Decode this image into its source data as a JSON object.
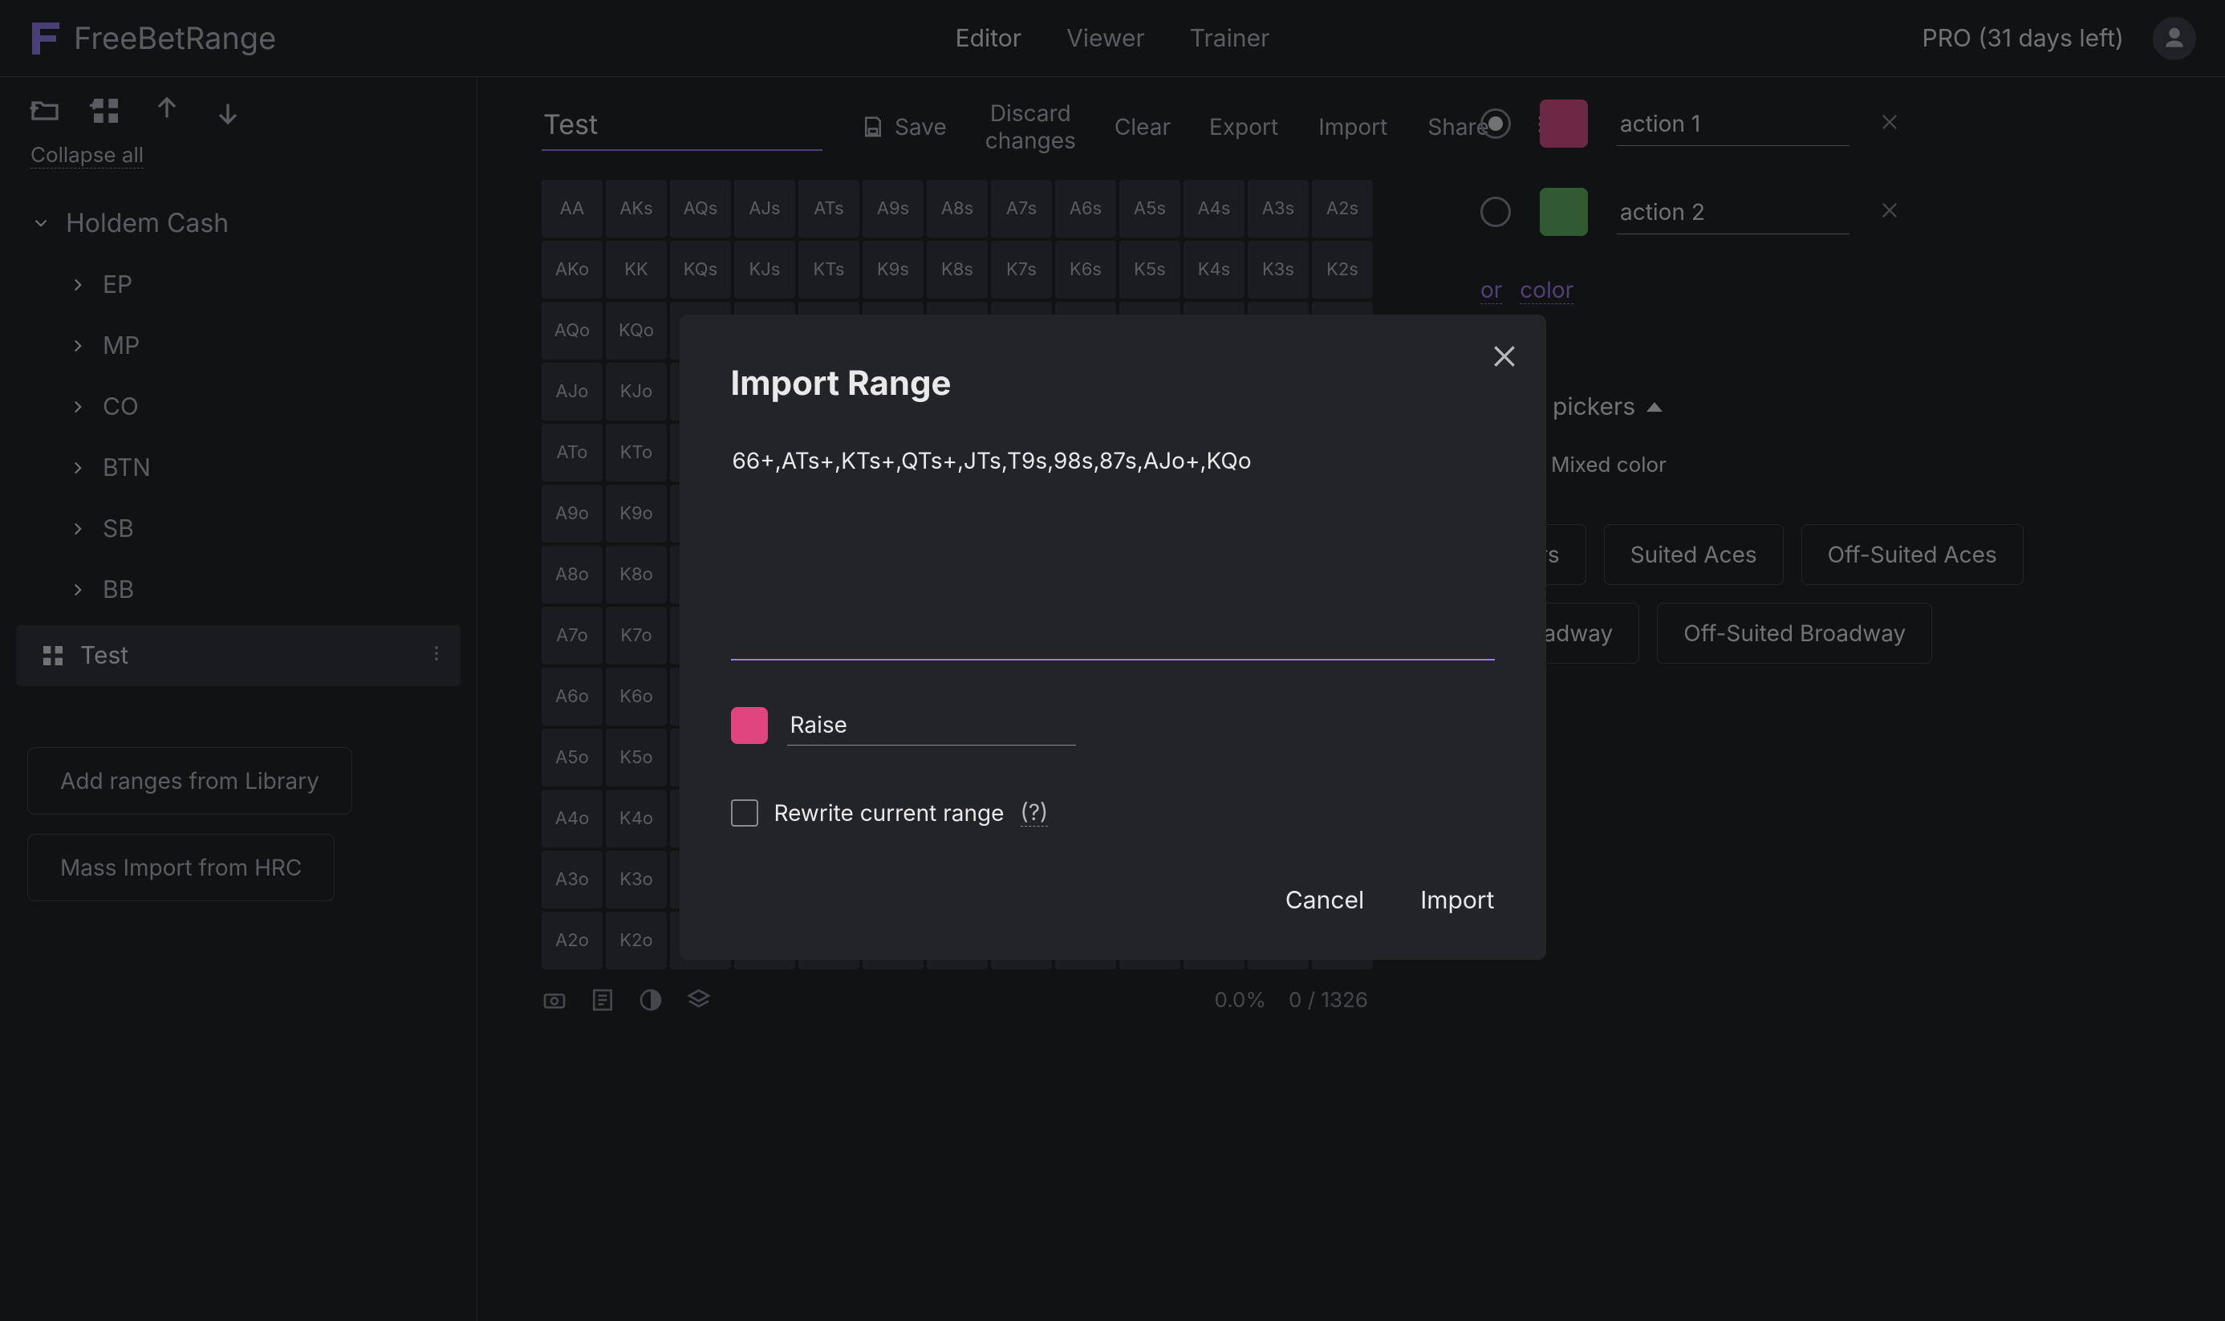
{
  "brand": "FreeBetRange",
  "nav": {
    "items": [
      "Editor",
      "Viewer",
      "Trainer"
    ],
    "active_index": 0
  },
  "pro_text": "PRO (31 days left)",
  "sidebar": {
    "collapse": "Collapse all",
    "root": "Holdem Cash",
    "positions": [
      "EP",
      "MP",
      "CO",
      "BTN",
      "SB",
      "BB"
    ],
    "leaf": "Test",
    "btn_add_library": "Add ranges from Library",
    "btn_mass_import": "Mass Import from HRC"
  },
  "page_title": "Test",
  "toolbar": {
    "save": "Save",
    "discard": "Discard changes",
    "clear": "Clear",
    "export": "Export",
    "import": "Import",
    "share": "Share"
  },
  "hand_grid": {
    "ranks": [
      "A",
      "K",
      "Q",
      "J",
      "T",
      "9",
      "8",
      "7",
      "6",
      "5",
      "4",
      "3",
      "2"
    ]
  },
  "grid_footer": {
    "percent": "0.0%",
    "combos": "0 / 1326"
  },
  "actions_panel": {
    "actions": [
      {
        "label": "action 1",
        "color_key": "pink",
        "checked": true
      },
      {
        "label": "action 2",
        "color_key": "green",
        "checked": false
      }
    ],
    "link_new_action": "or",
    "link_new_action2": "color",
    "quick_header": "Quick pickers",
    "mixed_color": "Mixed color",
    "chips": [
      "Pairs",
      "Suited Aces",
      "Off-Suited Aces",
      "Broadway",
      "Off-Suited Broadway"
    ]
  },
  "modal": {
    "title": "Import Range",
    "range_text": "66+,ATs+,KTs+,QTs+,JTs,T9s,98s,87s,AJo+,KQo",
    "action_name": "Raise",
    "rewrite_label": "Rewrite current range",
    "help_link": "(?)",
    "cancel": "Cancel",
    "import": "Import"
  }
}
